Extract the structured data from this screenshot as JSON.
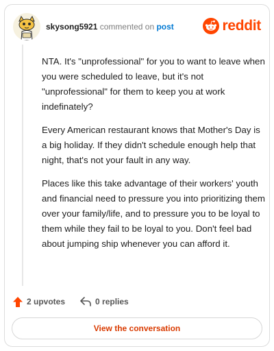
{
  "header": {
    "username": "skysong5921",
    "action": "commented on",
    "post_link": "post",
    "brand": "reddit"
  },
  "comment": {
    "paragraphs": [
      "NTA. It's \"unprofessional\" for you to want to leave when you were scheduled to leave, but it's not \"unprofessional\" for them to keep you at work indefinately?",
      "Every American restaurant knows that Mother's Day is a big holiday. If they didn't schedule enough help that night, that's not your fault in any way.",
      "Places like this take advantage of their workers' youth and financial need to pressure you into prioritizing them over your family/life, and to pressure you to be loyal to them while they fail to be loyal to you. Don't feel bad about jumping ship whenever you can afford it."
    ]
  },
  "actions": {
    "upvotes_label": "2 upvotes",
    "replies_label": "0 replies"
  },
  "footer": {
    "conversation_button": "View the conversation"
  },
  "colors": {
    "brand_orange": "#ff4500",
    "upvote": "#ff4500",
    "link_blue": "#0079d3",
    "button_text": "#d93a00"
  },
  "icons": {
    "avatar": "snoo-avatar",
    "logo": "reddit-alien-icon",
    "upvote": "upvote-arrow-icon",
    "reply": "reply-arrow-icon"
  }
}
